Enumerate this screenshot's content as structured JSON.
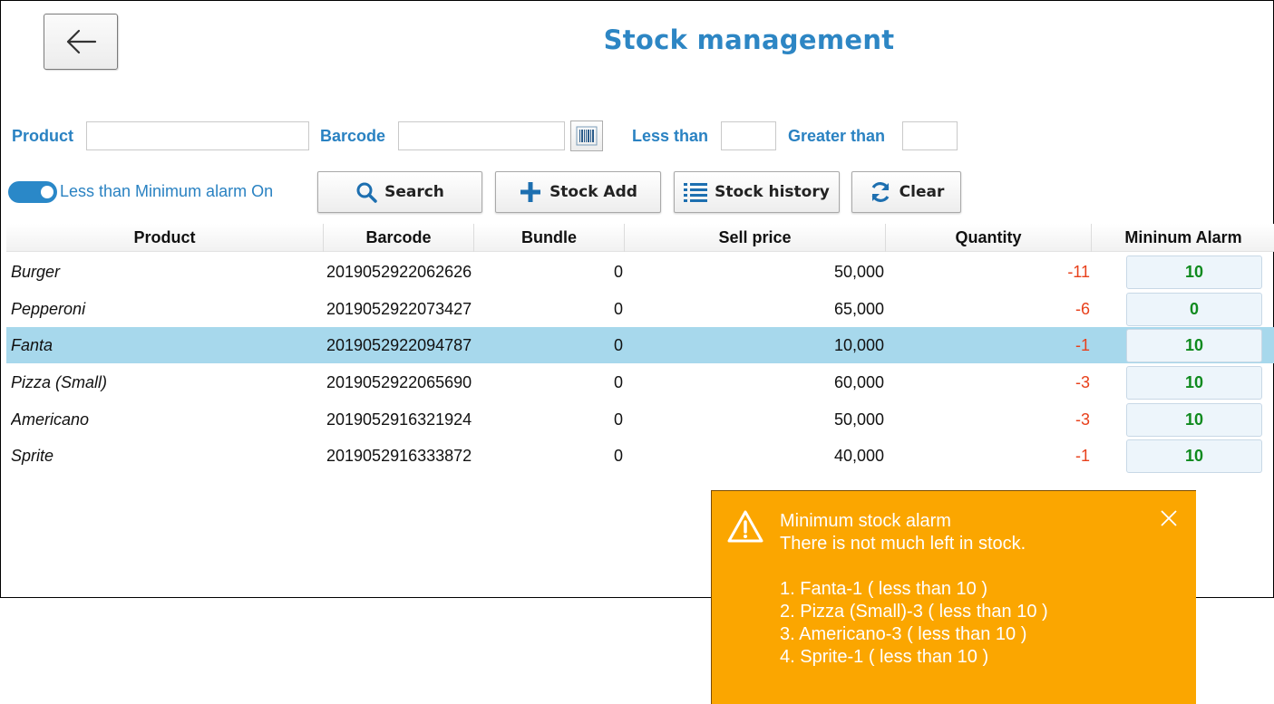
{
  "header": {
    "title": "Stock management",
    "back_icon": "arrow-left-icon"
  },
  "filters": {
    "product_label": "Product",
    "product_value": "",
    "barcode_label": "Barcode",
    "barcode_value": "",
    "barcode_icon": "barcode-icon",
    "less_than_label": "Less than",
    "less_than_value": "",
    "greater_than_label": "Greater than",
    "greater_than_value": ""
  },
  "toggle": {
    "label": "Less than Minimum alarm On",
    "on": true
  },
  "toolbar": {
    "search_label": "Search",
    "stock_add_label": "Stock Add",
    "stock_history_label": "Stock history",
    "clear_label": "Clear"
  },
  "table": {
    "columns": [
      "Product",
      "Barcode",
      "Bundle",
      "Sell price",
      "Quantity",
      "Mininum Alarm"
    ],
    "rows": [
      {
        "product": "Burger",
        "barcode": "2019052922062626",
        "bundle": "0",
        "sell_price": "50,000",
        "quantity": "-11",
        "min_alarm": "10"
      },
      {
        "product": "Pepperoni",
        "barcode": "2019052922073427",
        "bundle": "0",
        "sell_price": "65,000",
        "quantity": "-6",
        "min_alarm": "0"
      },
      {
        "product": "Fanta",
        "barcode": "2019052922094787",
        "bundle": "0",
        "sell_price": "10,000",
        "quantity": "-1",
        "min_alarm": "10"
      },
      {
        "product": "Pizza (Small)",
        "barcode": "2019052922065690",
        "bundle": "0",
        "sell_price": "60,000",
        "quantity": "-3",
        "min_alarm": "10"
      },
      {
        "product": "Americano",
        "barcode": "2019052916321924",
        "bundle": "0",
        "sell_price": "50,000",
        "quantity": "-3",
        "min_alarm": "10"
      },
      {
        "product": "Sprite",
        "barcode": "2019052916333872",
        "bundle": "0",
        "sell_price": "40,000",
        "quantity": "-1",
        "min_alarm": "10"
      }
    ],
    "selected_row": "Fanta"
  },
  "toast": {
    "title": "Minimum stock alarm",
    "message": "There is not much left in stock.",
    "items": [
      "1. Fanta-1 ( less than 10 )",
      "2. Pizza (Small)-3 ( less than 10 )",
      "3. Americano-3 ( less than 10 )",
      "4. Sprite-1 ( less than 10 )"
    ],
    "icon": "warning-icon",
    "close_icon": "close-icon"
  },
  "colors": {
    "accent": "#2a82c2",
    "title": "#2d86c4",
    "negative_quantity": "#e8401b",
    "alarm_value": "#0f8a1e",
    "selected_row": "#a7d8ec",
    "toast_bg": "#fba600"
  }
}
